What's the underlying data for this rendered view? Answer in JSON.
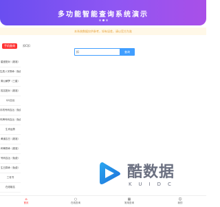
{
  "banner": {
    "title": "多功能智能查询系统演示",
    "dots": 3,
    "active_dot": 1
  },
  "notice": {
    "text": "本系统数据仅供参考，如有误差，请以官方为准"
  },
  "tag": {
    "label": "手机查询",
    "side": "扣C扣"
  },
  "search": {
    "value": "扣",
    "button": "查询"
  },
  "sidebar": {
    "items": [
      {
        "label": "星座配对（超准）"
      },
      {
        "label": "生辰八字算命（免费）"
      },
      {
        "label": "周公解梦（三星）"
      },
      {
        "label": "姓名配对（超准）"
      },
      {
        "label": "QQ吉凶"
      },
      {
        "label": "手机号码吉凶（免费）"
      },
      {
        "label": "车牌号码吉凶（免费）"
      },
      {
        "label": "生肖运势"
      },
      {
        "label": "黄道吉日（超准）"
      },
      {
        "label": "称骨算命（超准）"
      },
      {
        "label": "号码吉凶（免费）"
      },
      {
        "label": "生日算命（免费）"
      },
      {
        "label": "三世书"
      },
      {
        "label": "在线取名"
      }
    ]
  },
  "watermark": {
    "title": "酷数据",
    "subtitle": "KUIDC"
  },
  "tabbar": {
    "items": [
      {
        "label": "首页",
        "icon": "home-icon"
      },
      {
        "label": "在线查询",
        "icon": "search-icon"
      },
      {
        "label": "常用查询",
        "icon": "grid-icon"
      },
      {
        "label": "我的",
        "icon": "user-icon"
      }
    ]
  },
  "colors": {
    "banner_start": "#6a4ef0",
    "banner_end": "#a94fe8",
    "accent": "#409eff",
    "tag": "#ff3333",
    "notice_text": "#e6a23c"
  }
}
